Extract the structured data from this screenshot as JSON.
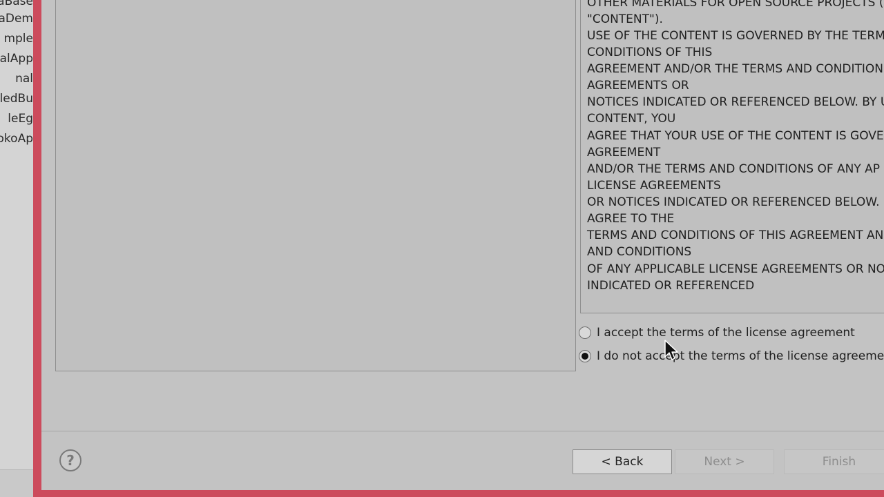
{
  "background_explorer": {
    "items": [
      "taBase",
      "taDem",
      "mple",
      "alApp",
      "nal",
      "ledBu",
      "leEg",
      "okoAp"
    ]
  },
  "license": {
    "lines": [
      "OTHER MATERIALS FOR OPEN SOURCE PROJECTS (",
      "\"CONTENT\").",
      "USE OF THE CONTENT IS GOVERNED BY THE TERMS",
      "CONDITIONS OF THIS",
      "AGREEMENT AND/OR THE TERMS AND CONDITION",
      "AGREEMENTS OR",
      "NOTICES INDICATED OR REFERENCED BELOW.  BY U",
      "CONTENT, YOU",
      "AGREE THAT YOUR USE OF THE CONTENT IS GOVER",
      "AGREEMENT",
      "AND/OR THE TERMS AND CONDITIONS OF ANY AP",
      "LICENSE AGREEMENTS",
      "OR NOTICES INDICATED OR REFERENCED BELOW.  I",
      "AGREE TO THE",
      "TERMS AND CONDITIONS OF THIS AGREEMENT AN",
      "AND CONDITIONS",
      "OF ANY APPLICABLE LICENSE AGREEMENTS OR NO",
      "INDICATED OR REFERENCED"
    ]
  },
  "options": {
    "accept_label": "I accept the terms of the license agreement",
    "decline_label": "I do not accept the terms of the license agreemen",
    "selected": "decline"
  },
  "footer": {
    "help_glyph": "?",
    "back_label": "< Back",
    "next_label": "Next >",
    "finish_label": "Finish"
  },
  "colors": {
    "window_border": "#cc4b5c",
    "dialog_bg": "#c3c3c3"
  }
}
